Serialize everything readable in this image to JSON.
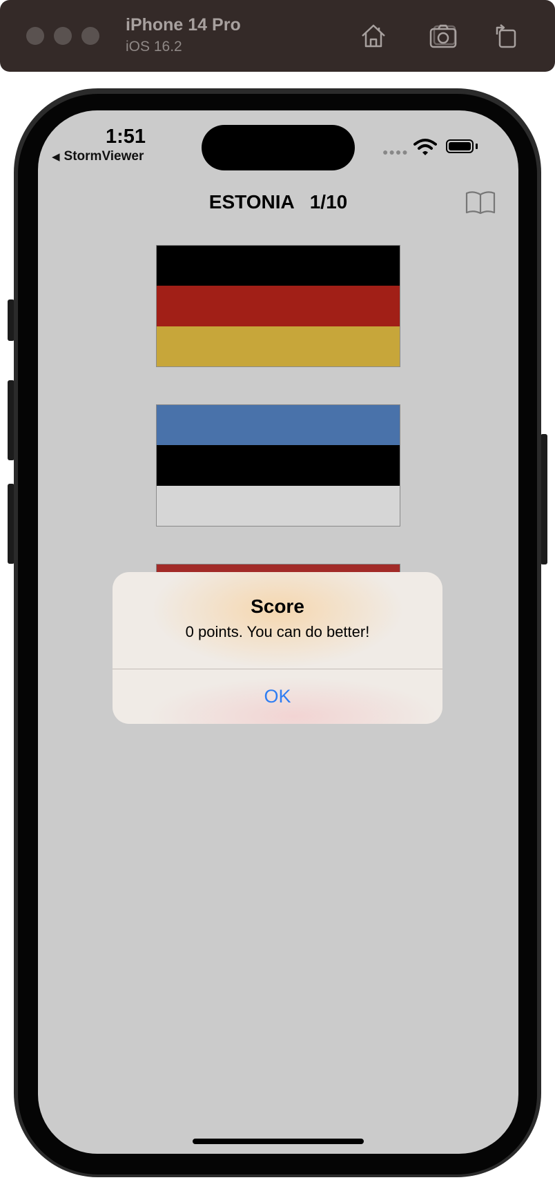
{
  "simulator": {
    "device_name": "iPhone 14 Pro",
    "os_version": "iOS 16.2",
    "toolbar_icons": [
      "home-icon",
      "screenshot-icon",
      "rotate-icon"
    ]
  },
  "status_bar": {
    "time": "1:51",
    "back_label": "StormViewer",
    "back_arrow": "◀"
  },
  "nav": {
    "country": "ESTONIA",
    "progress": "1/10",
    "right_icon": "book-icon"
  },
  "flags": [
    {
      "name": "flag-germany",
      "stripes": [
        "#000000",
        "#a11f17",
        "#c7a63a"
      ]
    },
    {
      "name": "flag-estonia",
      "stripes": [
        "#4972aa",
        "#000000",
        "#d6d6d6"
      ]
    },
    {
      "name": "flag-third",
      "stripes": [
        "#a22b28",
        "#cfcfcf",
        "#a22b28"
      ]
    }
  ],
  "alert": {
    "title": "Score",
    "message": "0 points. You can do better!",
    "button_label": "OK"
  },
  "colors": {
    "screen_background": "#cbcbcb",
    "alert_button": "#2f7df2",
    "simulator_bar": "#342a28"
  }
}
